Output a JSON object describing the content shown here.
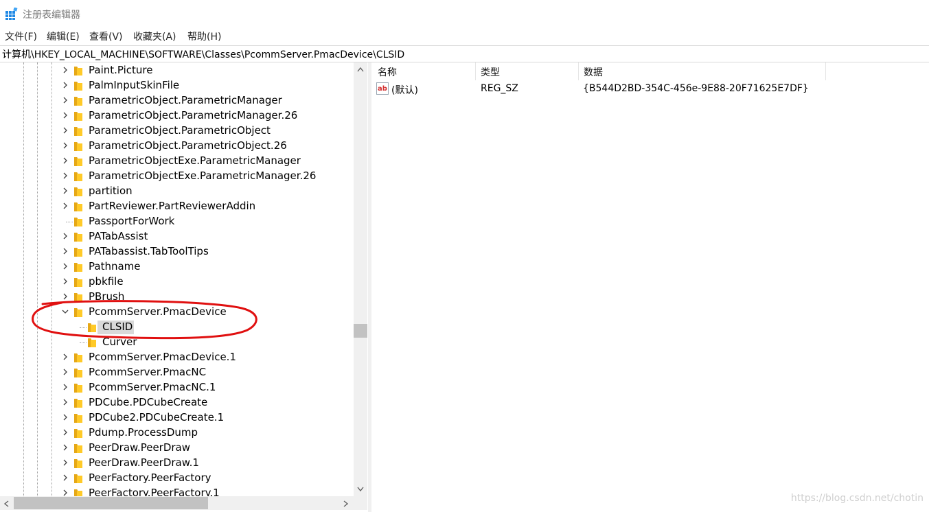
{
  "window": {
    "title": "注册表编辑器"
  },
  "menu": [
    "文件(F)",
    "编辑(E)",
    "查看(V)",
    "收藏夹(A)",
    "帮助(H)"
  ],
  "address": "计算机\\HKEY_LOCAL_MACHINE\\SOFTWARE\\Classes\\PcommServer.PmacDevice\\CLSID",
  "tree": {
    "items": [
      {
        "label": "Paint.Picture",
        "expander": "collapsed"
      },
      {
        "label": "PalmInputSkinFile",
        "expander": "collapsed"
      },
      {
        "label": "ParametricObject.ParametricManager",
        "expander": "collapsed"
      },
      {
        "label": "ParametricObject.ParametricManager.26",
        "expander": "collapsed"
      },
      {
        "label": "ParametricObject.ParametricObject",
        "expander": "collapsed"
      },
      {
        "label": "ParametricObject.ParametricObject.26",
        "expander": "collapsed"
      },
      {
        "label": "ParametricObjectExe.ParametricManager",
        "expander": "collapsed"
      },
      {
        "label": "ParametricObjectExe.ParametricManager.26",
        "expander": "collapsed"
      },
      {
        "label": "partition",
        "expander": "collapsed"
      },
      {
        "label": "PartReviewer.PartReviewerAddin",
        "expander": "collapsed"
      },
      {
        "label": "PassportForWork",
        "expander": "none"
      },
      {
        "label": "PATabAssist",
        "expander": "collapsed"
      },
      {
        "label": "PATabassist.TabToolTips",
        "expander": "collapsed"
      },
      {
        "label": "Pathname",
        "expander": "collapsed"
      },
      {
        "label": "pbkfile",
        "expander": "collapsed"
      },
      {
        "label": "PBrush",
        "expander": "collapsed"
      },
      {
        "label": "PcommServer.PmacDevice",
        "expander": "expanded"
      },
      {
        "label": "CLSID",
        "expander": "child",
        "selected": true
      },
      {
        "label": "Curver",
        "expander": "child"
      },
      {
        "label": "PcommServer.PmacDevice.1",
        "expander": "collapsed"
      },
      {
        "label": "PcommServer.PmacNC",
        "expander": "collapsed"
      },
      {
        "label": "PcommServer.PmacNC.1",
        "expander": "collapsed"
      },
      {
        "label": "PDCube.PDCubeCreate",
        "expander": "collapsed"
      },
      {
        "label": "PDCube2.PDCubeCreate.1",
        "expander": "collapsed"
      },
      {
        "label": "Pdump.ProcessDump",
        "expander": "collapsed"
      },
      {
        "label": "PeerDraw.PeerDraw",
        "expander": "collapsed"
      },
      {
        "label": "PeerDraw.PeerDraw.1",
        "expander": "collapsed"
      },
      {
        "label": "PeerFactory.PeerFactory",
        "expander": "collapsed"
      },
      {
        "label": "PeerFactory.PeerFactory.1",
        "expander": "collapsed"
      }
    ]
  },
  "list": {
    "columns": [
      "名称",
      "类型",
      "数据"
    ],
    "rows": [
      {
        "name": "(默认)",
        "type": "REG_SZ",
        "data": "{B544D2BD-354C-456e-9E88-20F71625E7DF}"
      }
    ]
  },
  "watermark": "https://blog.csdn.net/chotin",
  "colors": {
    "folder": "#ffca28",
    "highlight": "#d9d9d9",
    "annotation": "#e01010",
    "app_icon": "#1e88e5"
  },
  "icons": {
    "app": "registry-icon",
    "folder": "folder-icon",
    "value": "string-value-icon"
  }
}
